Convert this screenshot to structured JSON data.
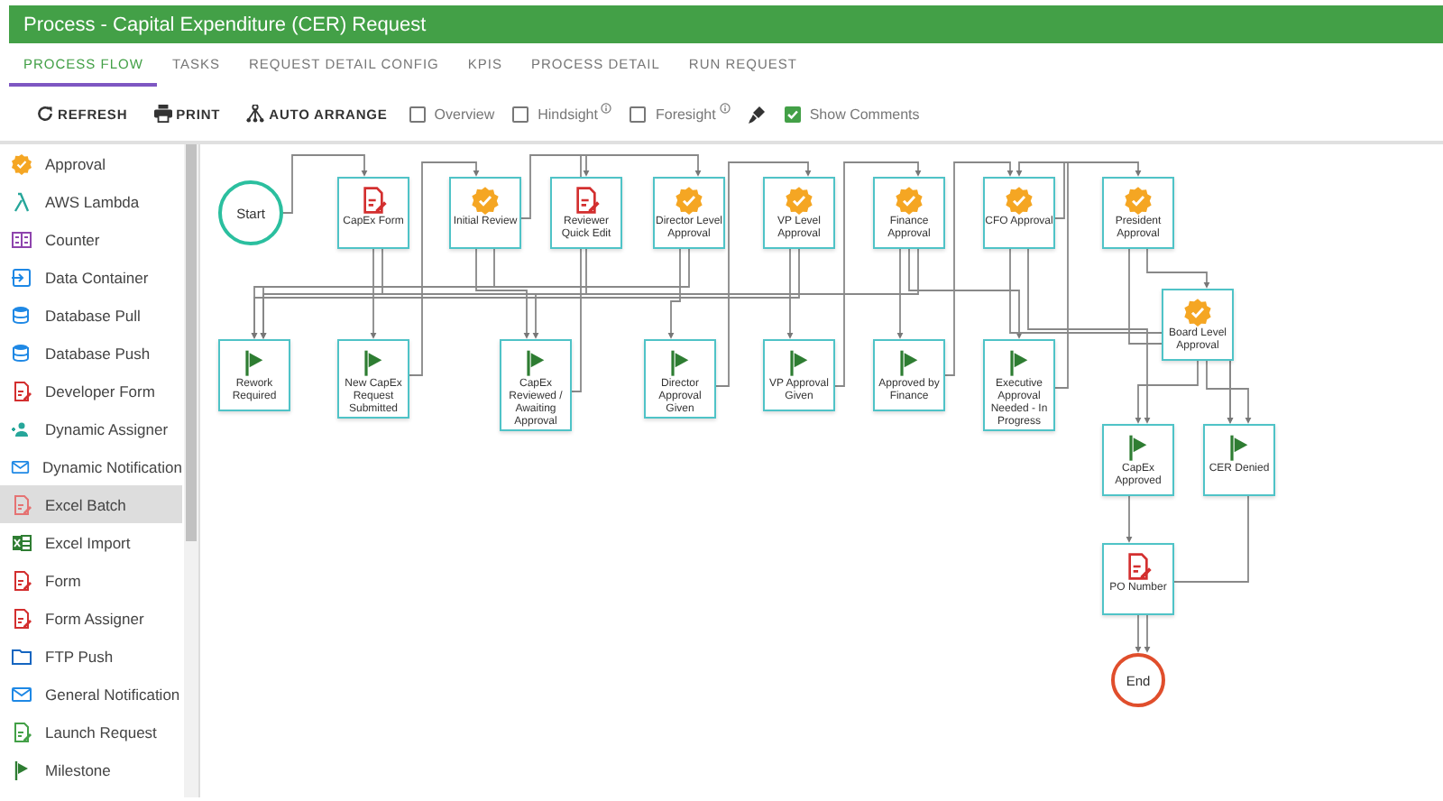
{
  "window": {
    "title": "Process - Capital Expenditure (CER) Request"
  },
  "tabs": [
    {
      "label": "PROCESS FLOW",
      "selected": true
    },
    {
      "label": "TASKS",
      "selected": false
    },
    {
      "label": "REQUEST DETAIL CONFIG",
      "selected": false
    },
    {
      "label": "KPIS",
      "selected": false
    },
    {
      "label": "PROCESS DETAIL",
      "selected": false
    },
    {
      "label": "RUN REQUEST",
      "selected": false
    }
  ],
  "toolbar": {
    "buttons": [
      {
        "label": "REFRESH",
        "kind": "refresh"
      },
      {
        "label": "PRINT",
        "kind": "print"
      },
      {
        "label": "AUTO ARRANGE",
        "kind": "arrange"
      }
    ],
    "options": [
      {
        "kind": "checkbox",
        "label": "Overview",
        "checked": false,
        "info": false
      },
      {
        "kind": "checkbox",
        "label": "Hindsight",
        "checked": false,
        "info": true
      },
      {
        "kind": "checkbox",
        "label": "Foresight",
        "checked": false,
        "info": true
      },
      {
        "kind": "brush"
      },
      {
        "kind": "checkbox",
        "label": "Show Comments",
        "checked": true,
        "info": false
      }
    ]
  },
  "sidebar": {
    "items": [
      {
        "label": "Approval",
        "selected": false
      },
      {
        "label": "AWS Lambda",
        "selected": false
      },
      {
        "label": "Counter",
        "selected": false
      },
      {
        "label": "Data Container",
        "selected": false
      },
      {
        "label": "Database Pull",
        "selected": false
      },
      {
        "label": "Database Push",
        "selected": false
      },
      {
        "label": "Developer Form",
        "selected": false
      },
      {
        "label": "Dynamic Assigner",
        "selected": false
      },
      {
        "label": "Dynamic Notification",
        "selected": false
      },
      {
        "label": "Excel Batch",
        "selected": true
      },
      {
        "label": "Excel Import",
        "selected": false
      },
      {
        "label": "Form",
        "selected": false
      },
      {
        "label": "Form Assigner",
        "selected": false
      },
      {
        "label": "FTP Push",
        "selected": false
      },
      {
        "label": "General Notification",
        "selected": false
      },
      {
        "label": "Launch Request",
        "selected": false
      },
      {
        "label": "Milestone",
        "selected": false
      }
    ]
  },
  "flow": {
    "nodes": [
      {
        "kind": "start",
        "label": "Start"
      },
      {
        "kind": "form",
        "label": "CapEx Form"
      },
      {
        "kind": "approval",
        "label": "Initial Review"
      },
      {
        "kind": "form",
        "label": "Reviewer Quick Edit"
      },
      {
        "kind": "approval",
        "label": "Director Level Approval"
      },
      {
        "kind": "approval",
        "label": "VP Level Approval"
      },
      {
        "kind": "approval",
        "label": "Finance Approval"
      },
      {
        "kind": "approval",
        "label": "CFO Approval"
      },
      {
        "kind": "approval",
        "label": "President Approval"
      },
      {
        "kind": "approval",
        "label": "Board Level Approval"
      },
      {
        "kind": "milestone",
        "label": "Rework Required"
      },
      {
        "kind": "milestone",
        "label": "New CapEx Request Submitted"
      },
      {
        "kind": "milestone",
        "label": "CapEx Reviewed / Awaiting Approval"
      },
      {
        "kind": "milestone",
        "label": "Director Approval Given"
      },
      {
        "kind": "milestone",
        "label": "VP Approval Given"
      },
      {
        "kind": "milestone",
        "label": "Approved by Finance"
      },
      {
        "kind": "milestone",
        "label": "Executive Approval Needed - In Progress"
      },
      {
        "kind": "milestone",
        "label": "CapEx Approved"
      },
      {
        "kind": "milestone",
        "label": "CER Denied"
      },
      {
        "kind": "form",
        "label": "PO Number"
      },
      {
        "kind": "end",
        "label": "End"
      }
    ]
  }
}
